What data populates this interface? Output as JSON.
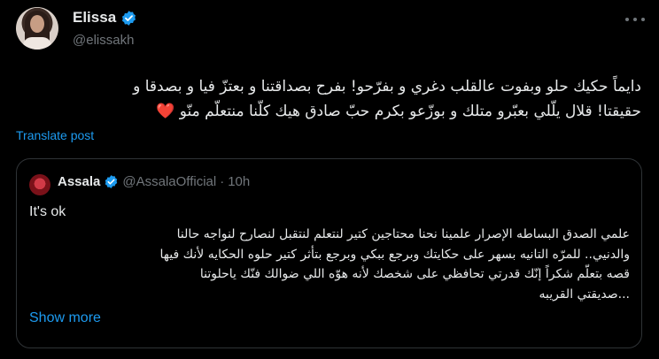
{
  "author": {
    "display_name": "Elissa",
    "handle": "@elissakh",
    "verified_icon": "verified-badge-icon",
    "avatar_icon": "avatar"
  },
  "post": {
    "line1": "دايماً حكيك حلو وبفوت عالقلب دغري و بفرّحو! بفرح بصداقتنا و بعتزّ فيا و بصدقا و",
    "line2": "حقيقتا! قلال يلّلي بعبّرو متلك و بوزّعو بكرم حبّ صادق هيك كلّنا منتعلّم منّو",
    "heart": "❤️"
  },
  "translate_label": "Translate post",
  "quote": {
    "display_name": "Assala",
    "handle": "@AssalaOfficial",
    "separator": "·",
    "time": "10h",
    "first_line": "It's ok",
    "body_lines": [
      "علمي الصدق البساطه الإصرار علمينا نحنا محتاجين كتير لنتعلم لنتقبل لنصارح لنواجه حالنا",
      "والدنيي.. للمرّه التانيه بسهر على حكايتك وبرجع ببكي وبرجع بتأثر كتير حلوه الحكايه لأنك فيها",
      "قصه بتعلّم شكراً إنّك قدرتي تحافظي على شخصك لأنه هوّه اللي ضوالك فنّك ياحلوتنا",
      "...صديقتي القريبه"
    ],
    "show_more_label": "Show more"
  },
  "colors": {
    "background": "#000000",
    "text": "#e7e9ea",
    "secondary": "#71767b",
    "accent": "#1d9bf0",
    "border": "#2f3336",
    "heart": "#f4212e"
  }
}
